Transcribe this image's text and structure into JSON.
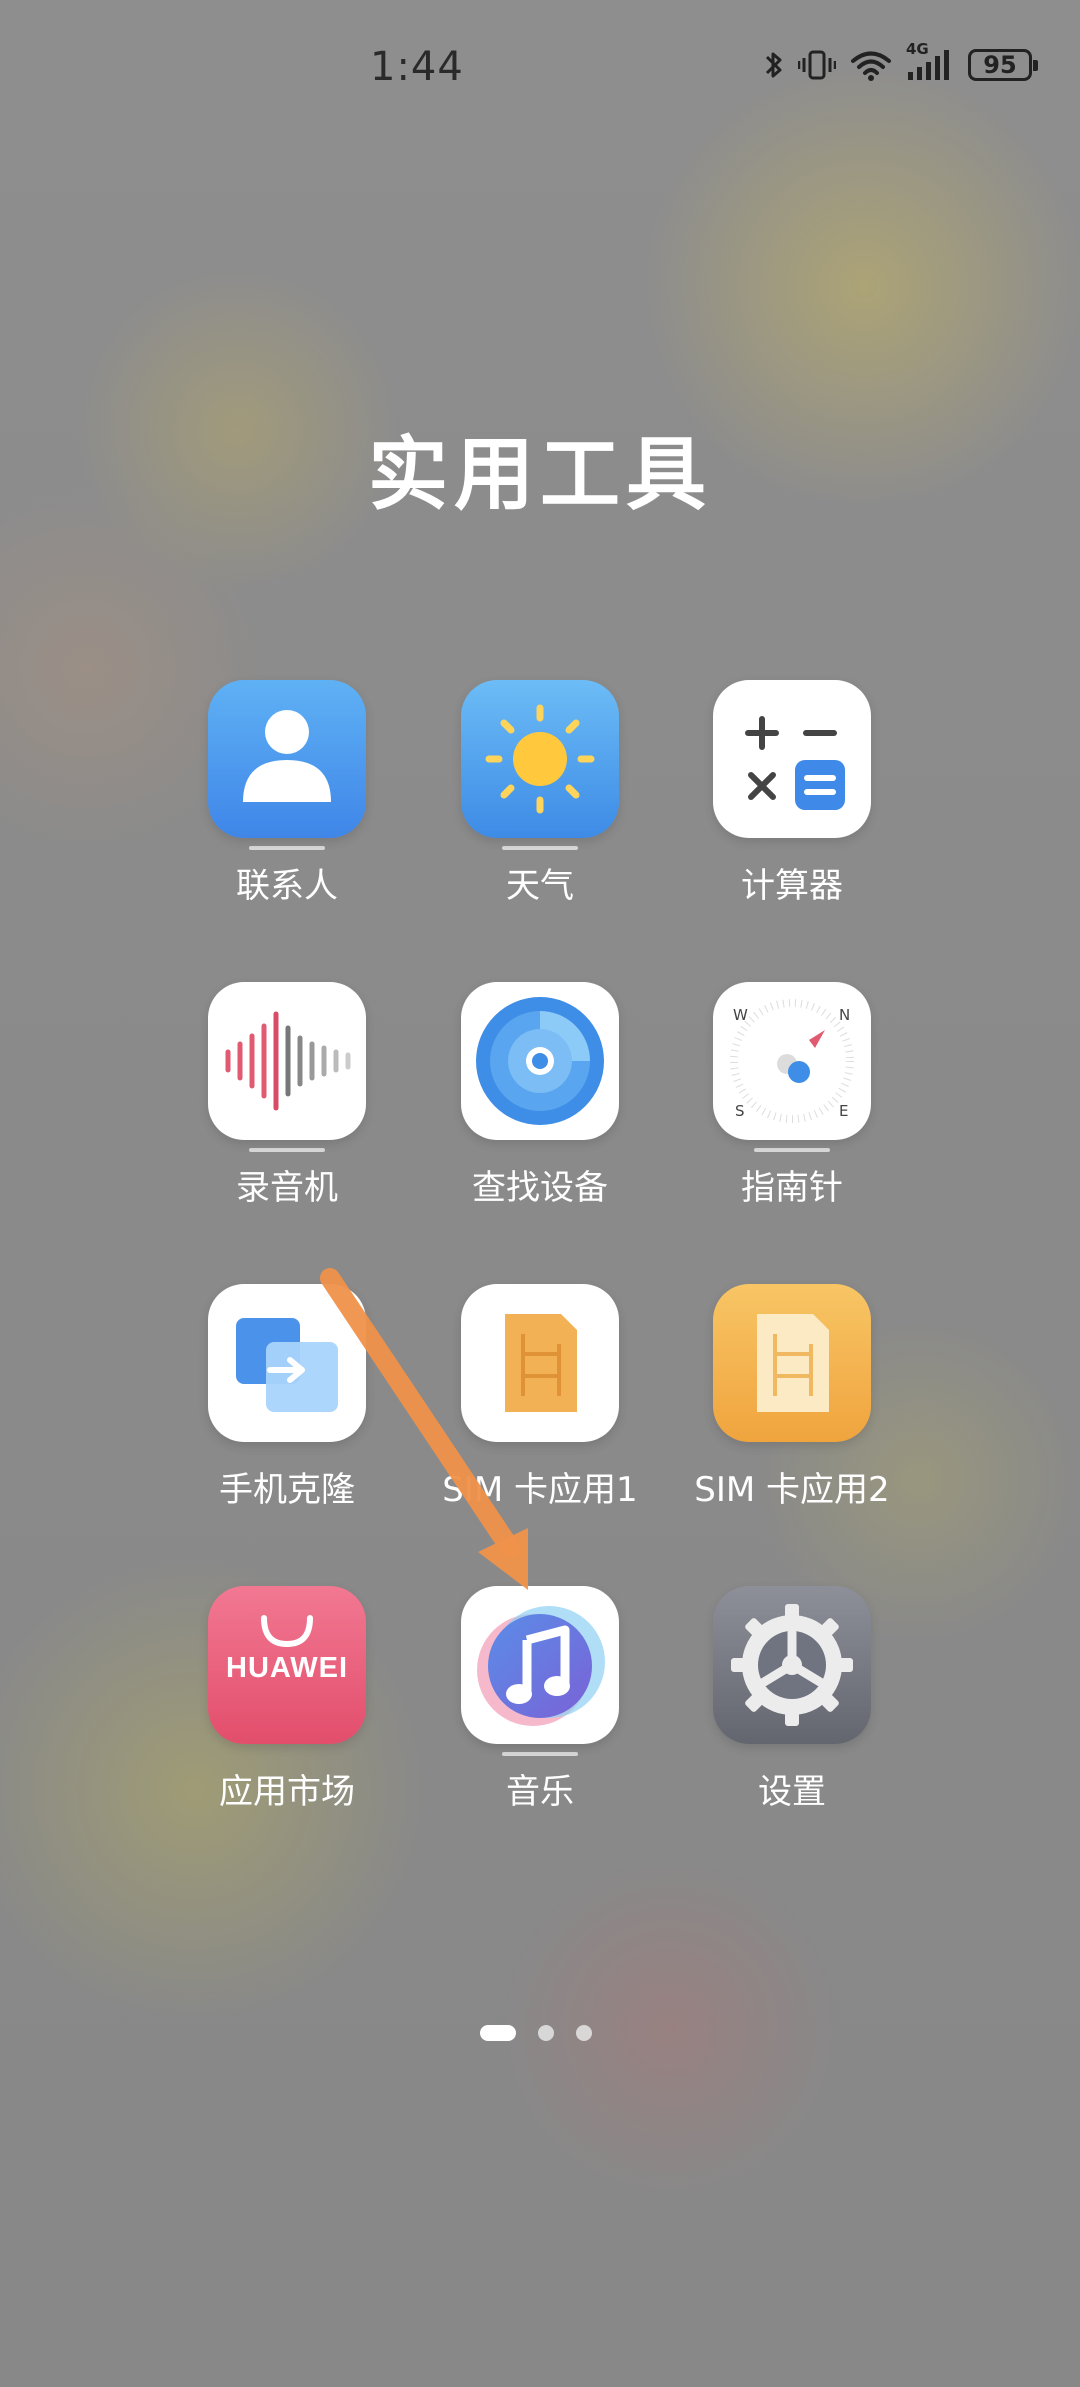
{
  "status_bar": {
    "time": "1:44",
    "network": "4G",
    "battery": "95",
    "icons": [
      "bluetooth-icon",
      "vibrate-icon",
      "wifi-icon",
      "signal-icon",
      "battery-icon"
    ]
  },
  "folder": {
    "title": "实用工具"
  },
  "apps": [
    {
      "label": "联系人",
      "icon": "contacts-icon"
    },
    {
      "label": "天气",
      "icon": "weather-sun-icon"
    },
    {
      "label": "计算器",
      "icon": "calculator-icon"
    },
    {
      "label": "录音机",
      "icon": "recorder-waveform-icon"
    },
    {
      "label": "查找设备",
      "icon": "find-device-radar-icon"
    },
    {
      "label": "指南针",
      "icon": "compass-icon"
    },
    {
      "label": "手机克隆",
      "icon": "phone-clone-icon"
    },
    {
      "label": "SIM 卡应用1",
      "icon": "sim-card-icon"
    },
    {
      "label": "SIM 卡应用2",
      "icon": "sim-card-icon"
    },
    {
      "label": "应用市场",
      "icon": "app-gallery-icon",
      "logo_text": "HUAWEI"
    },
    {
      "label": "音乐",
      "icon": "music-note-icon"
    },
    {
      "label": "设置",
      "icon": "settings-gear-icon"
    }
  ],
  "pagination": {
    "pages": 3,
    "active_index": 0
  },
  "colors": {
    "annotation_arrow": "#f0924a",
    "background": "#8b8b8b"
  }
}
